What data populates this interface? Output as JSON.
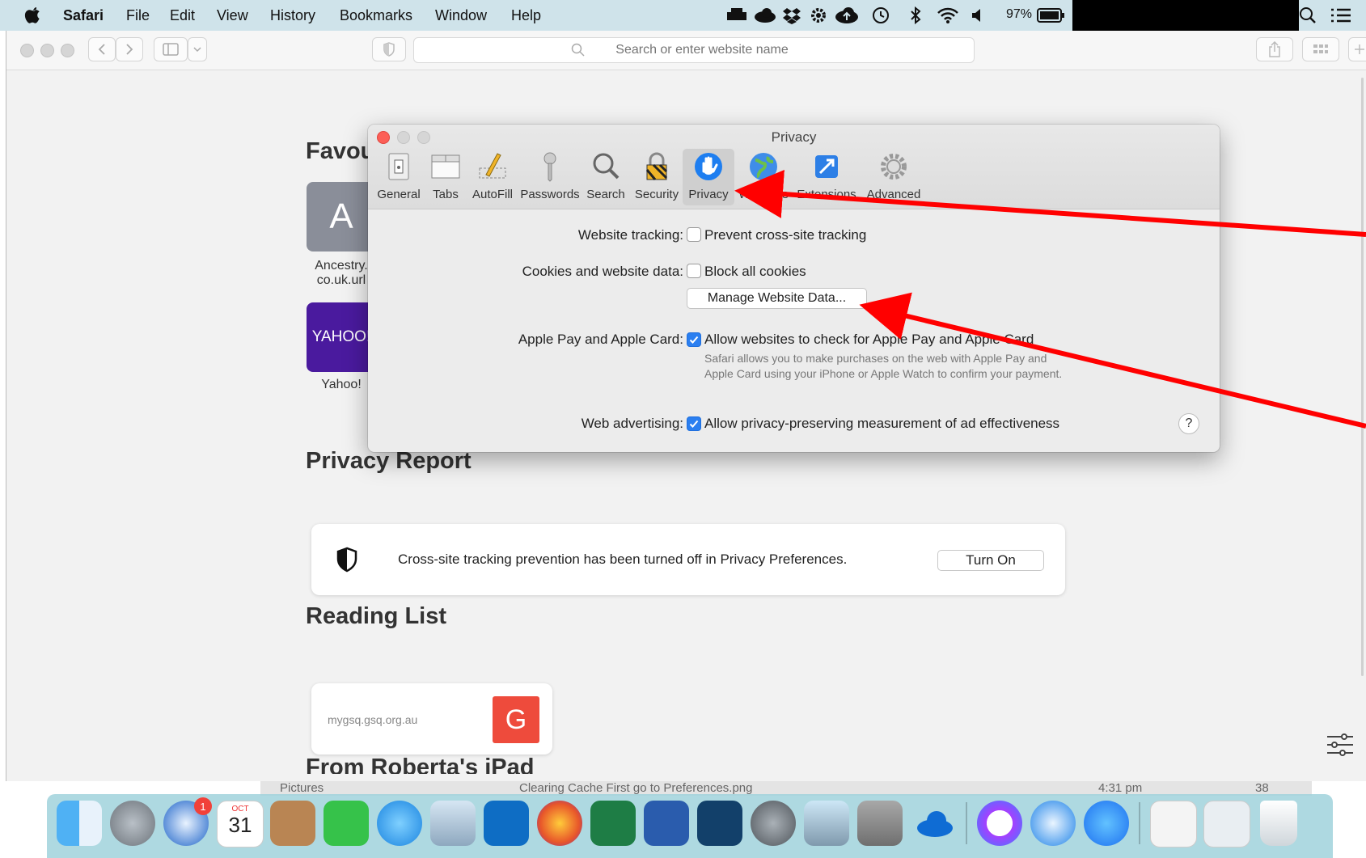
{
  "menubar": {
    "app_name": "Safari",
    "items": [
      "File",
      "Edit",
      "View",
      "History",
      "Bookmarks",
      "Window",
      "Help"
    ],
    "battery": "97%"
  },
  "toolbar": {
    "search_placeholder": "Search or enter website name"
  },
  "start_page": {
    "favourites_title": "Favou",
    "favourites": [
      {
        "tile_text": "A",
        "label_line1": "Ancestry.",
        "label_line2": "co.uk.url",
        "color": "#8a8e99"
      },
      {
        "tile_text": "YAHOO!",
        "label_line1": "Yahoo!",
        "label_line2": "",
        "color": "#4a1a9e"
      }
    ],
    "privacy_report_title": "Privacy Report",
    "privacy_report_text": "Cross-site tracking prevention has been turned off in Privacy Preferences.",
    "turn_on_label": "Turn On",
    "reading_list_title": "Reading List",
    "reading_item_url": "mygsq.gsq.org.au",
    "reading_item_letter": "G",
    "from_ipad_title": "From Roberta's iPad"
  },
  "prefs": {
    "title": "Privacy",
    "tabs": [
      {
        "label": "General",
        "icon": "general-icon"
      },
      {
        "label": "Tabs",
        "icon": "tabs-icon"
      },
      {
        "label": "AutoFill",
        "icon": "autofill-icon"
      },
      {
        "label": "Passwords",
        "icon": "passwords-icon"
      },
      {
        "label": "Search",
        "icon": "search-icon"
      },
      {
        "label": "Security",
        "icon": "security-icon"
      },
      {
        "label": "Privacy",
        "icon": "privacy-icon"
      },
      {
        "label": "Websites",
        "icon": "websites-icon"
      },
      {
        "label": "Extensions",
        "icon": "extensions-icon"
      },
      {
        "label": "Advanced",
        "icon": "advanced-icon"
      }
    ],
    "website_tracking_label": "Website tracking:",
    "website_tracking_option": "Prevent cross-site tracking",
    "website_tracking_checked": false,
    "cookies_label": "Cookies and website data:",
    "cookies_option": "Block all cookies",
    "cookies_checked": false,
    "manage_button": "Manage Website Data...",
    "applepay_label": "Apple Pay and Apple Card:",
    "applepay_option": "Allow websites to check for Apple Pay and Apple Card",
    "applepay_checked": true,
    "applepay_note": "Safari allows you to make purchases on the web with Apple Pay and Apple Card using your iPhone or Apple Watch to confirm your payment.",
    "advertising_label": "Web advertising:",
    "advertising_option": "Allow privacy-preserving measurement of ad effectiveness",
    "advertising_checked": true,
    "help_label": "?"
  },
  "background_bar": {
    "folder": "Pictures",
    "file": "Clearing Cache First go to Preferences.png",
    "time": "4:31 pm",
    "size": "38"
  },
  "dock": {
    "calendar_month": "OCT",
    "calendar_day": "31",
    "mail_badge": "1",
    "icons": [
      "finder-icon",
      "launchpad-icon",
      "thunderbird-icon",
      "calendar-icon",
      "contacts-icon",
      "facetime-icon",
      "messages-icon",
      "preview-icon",
      "outlook-icon",
      "firefox-icon",
      "excel-icon",
      "word-icon",
      "family-tree-icon",
      "system-preferences-icon",
      "image-capture-icon",
      "calculator-icon",
      "onedrive-icon",
      "messenger-icon",
      "safari-icon",
      "app-store-icon",
      "downloads-stack-icon",
      "documents-stack-icon",
      "trash-icon"
    ]
  },
  "annotations": {
    "arrow_color": "#ff0000"
  }
}
